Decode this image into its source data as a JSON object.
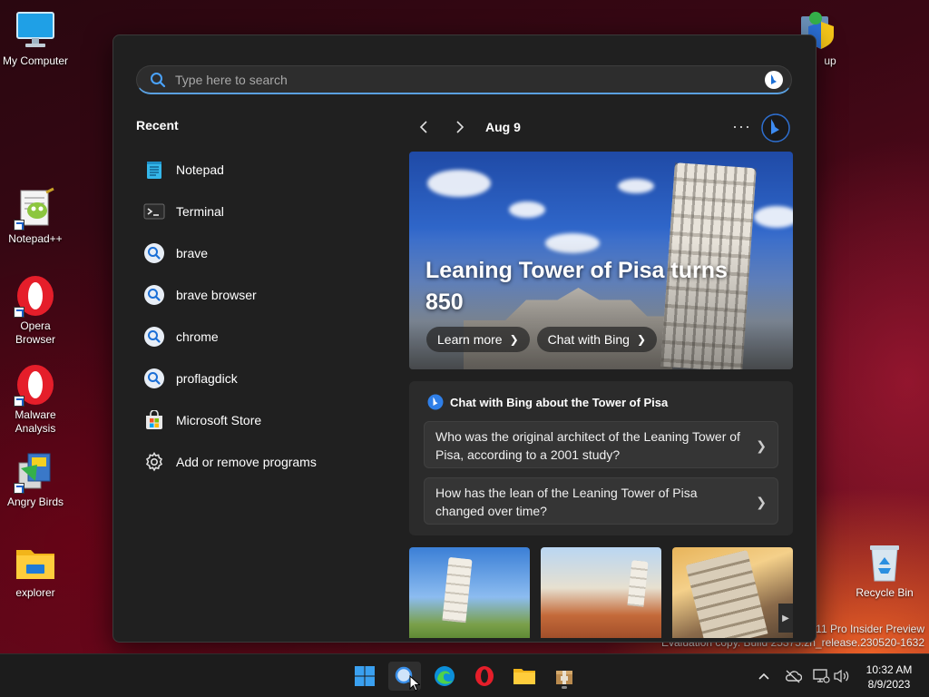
{
  "desktop": {
    "icons": {
      "my_computer": "My Computer",
      "setup": "up",
      "notepadpp": "Notepad++",
      "opera": "Opera\nBrowser",
      "malware": "Malware\nAnalysis",
      "angry_birds": "Angry Birds",
      "explorer": "explorer",
      "recycle_bin": "Recycle Bin"
    },
    "watermark_line1": "s 11 Pro Insider Preview",
    "watermark_line2": "Evaluation copy. Build 25375.zn_release.230520-1632"
  },
  "search": {
    "placeholder": "Type here to search"
  },
  "recent": {
    "title": "Recent",
    "items": [
      {
        "label": "Notepad",
        "icon": "notepad-icon"
      },
      {
        "label": "Terminal",
        "icon": "terminal-icon"
      },
      {
        "label": "brave",
        "icon": "search-icon"
      },
      {
        "label": "brave browser",
        "icon": "search-icon"
      },
      {
        "label": "chrome",
        "icon": "search-icon"
      },
      {
        "label": "proflagdick",
        "icon": "search-icon"
      },
      {
        "label": "Microsoft Store",
        "icon": "store-icon"
      },
      {
        "label": "Add or remove programs",
        "icon": "gear-icon"
      }
    ]
  },
  "highlights": {
    "date": "Aug 9",
    "more": "···",
    "hero": {
      "title": "Leaning Tower of Pisa turns 850",
      "learn_more": "Learn more",
      "chat_with_bing": "Chat with Bing"
    },
    "chat": {
      "title": "Chat with Bing about the Tower of Pisa",
      "q1": "Who was the original architect of the Leaning Tower of Pisa, according to a 2001 study?",
      "q2": "How has the lean of the Leaning Tower of Pisa changed over time?"
    }
  },
  "taskbar": {
    "time": "10:32 AM",
    "date": "8/9/2023"
  },
  "colors": {
    "accent": "#4aa3ff",
    "panel_bg": "#202020",
    "card_bg": "#2b2b2b"
  }
}
